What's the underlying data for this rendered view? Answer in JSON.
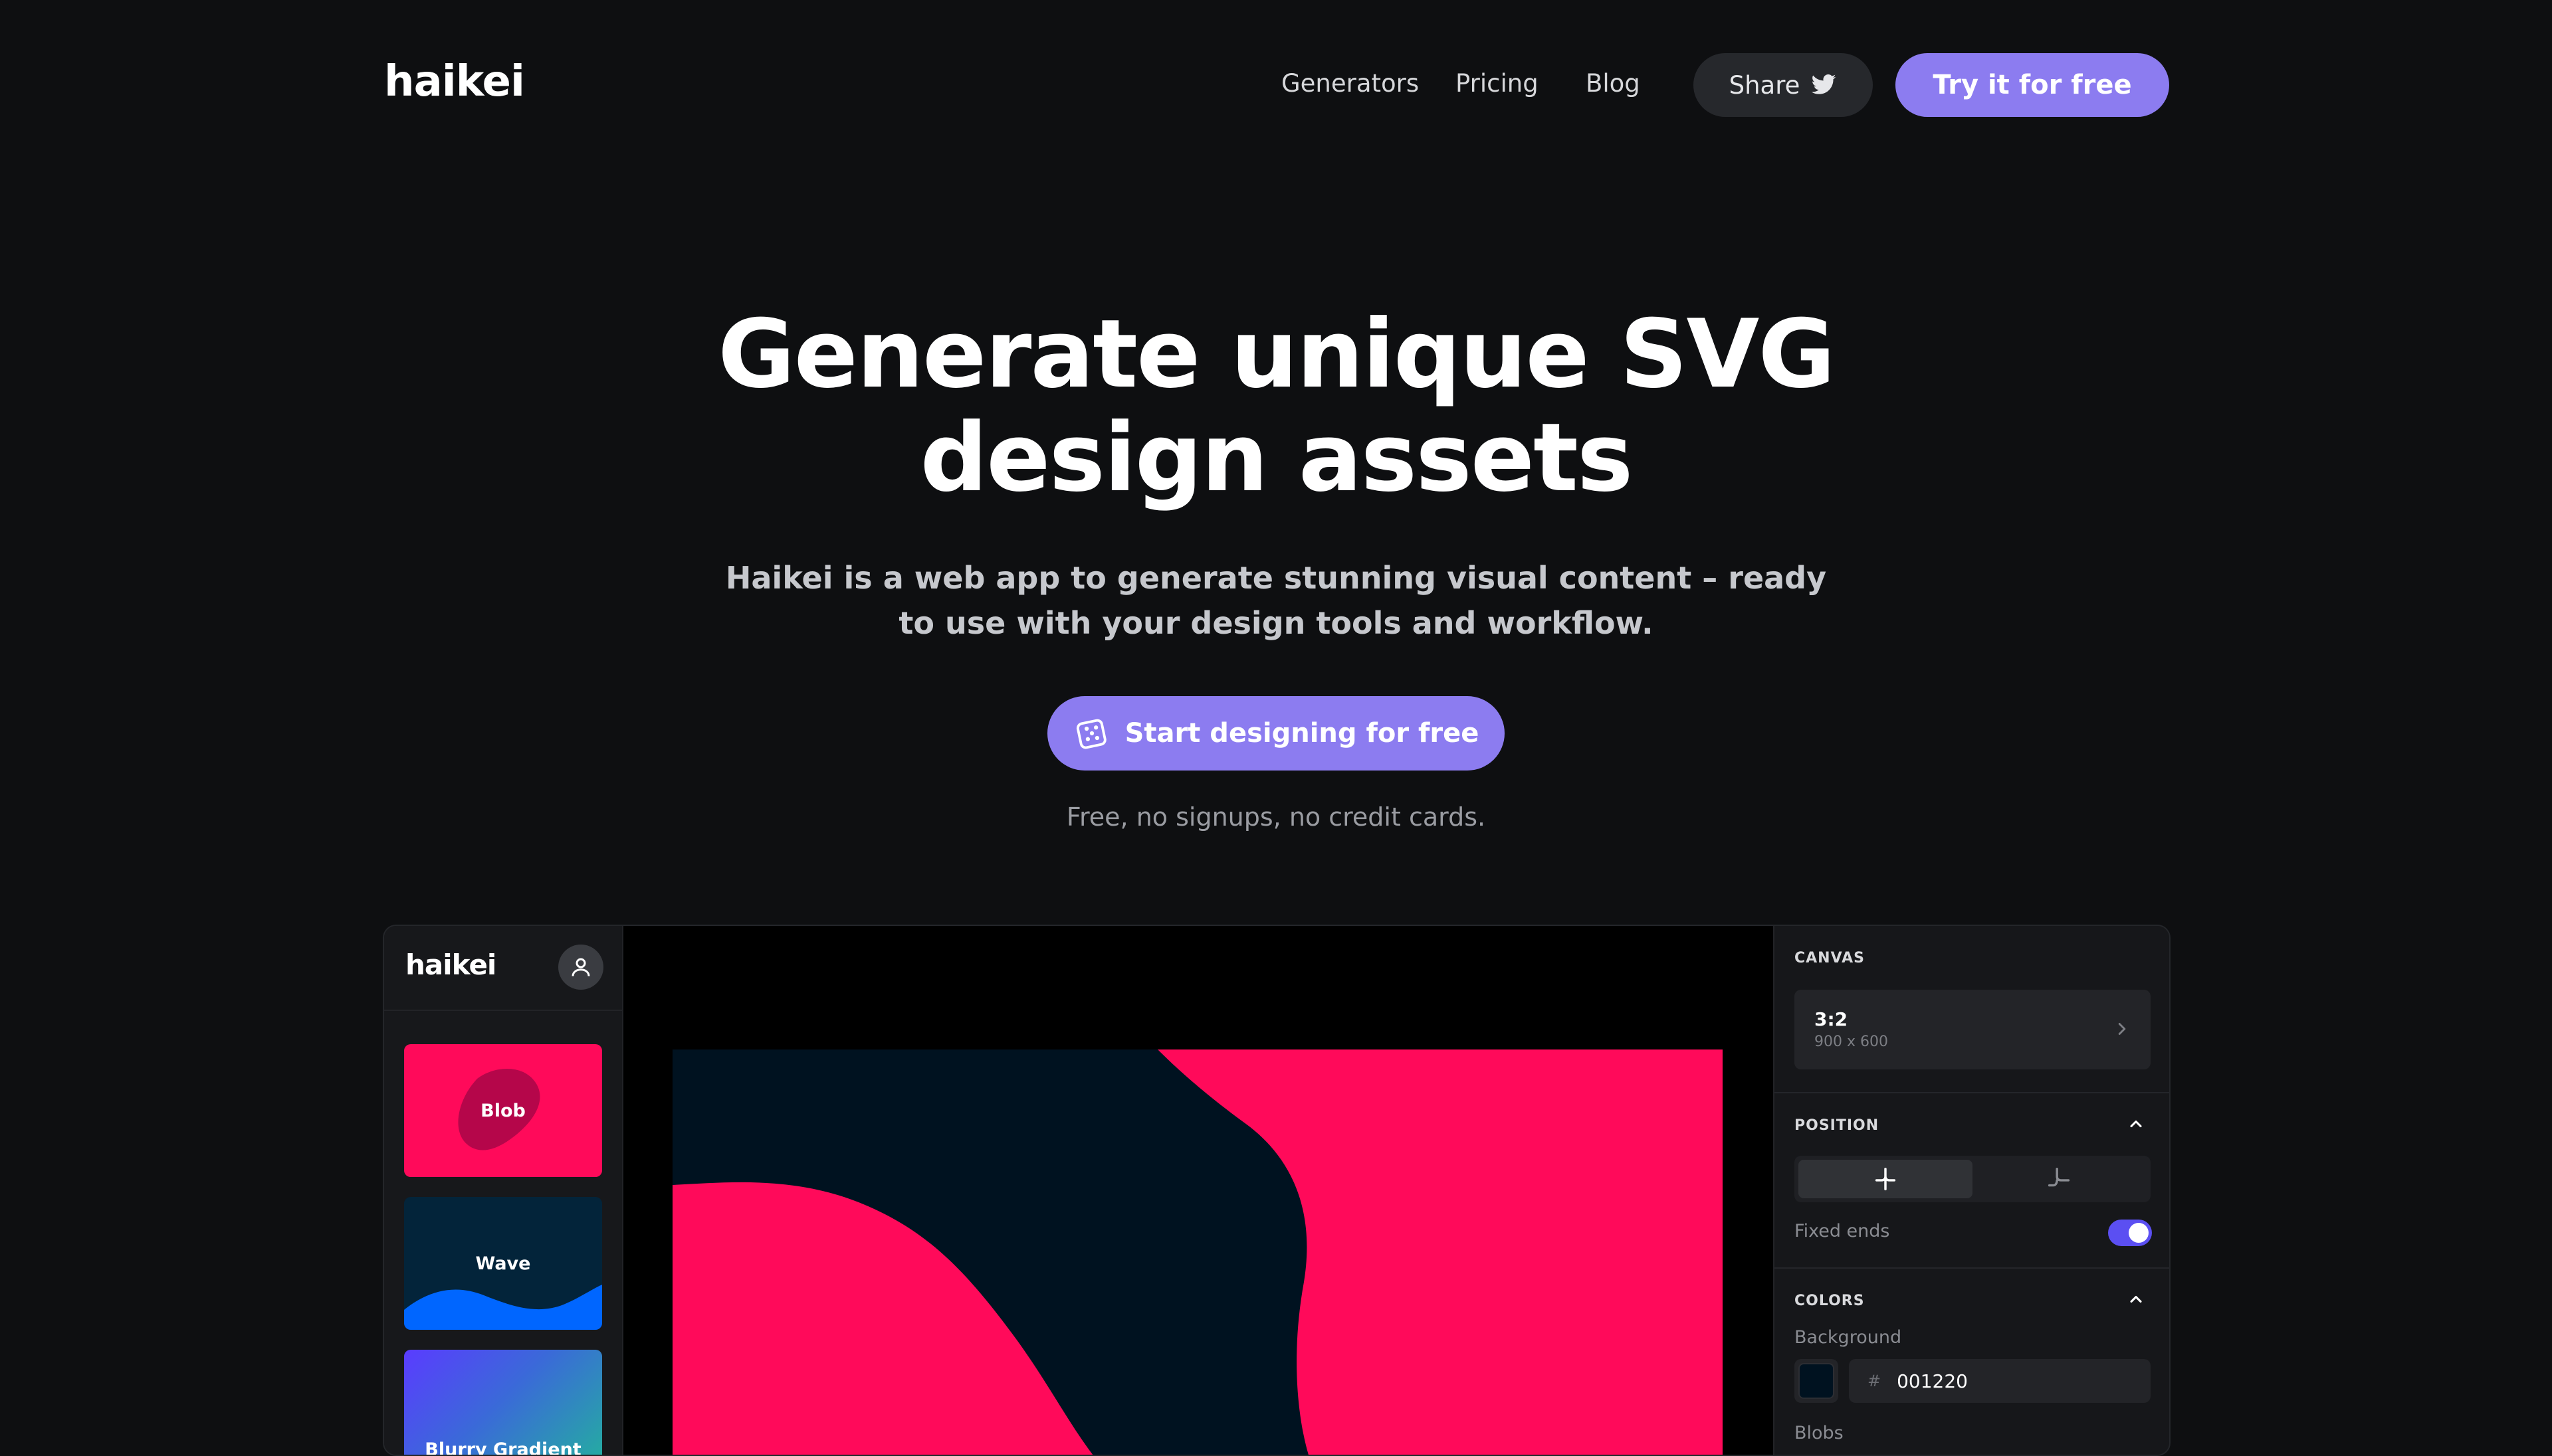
{
  "nav": {
    "logo": "haikei",
    "links": [
      "Generators",
      "Pricing",
      "Blog"
    ],
    "share_label": "Share",
    "try_label": "Try it for free"
  },
  "hero": {
    "title_line1": "Generate unique SVG",
    "title_line2": "design assets",
    "subtitle": "Haikei is a web app to generate stunning visual content – ready to use with your design tools and workflow.",
    "cta_label": "Start designing for free",
    "cta_note": "Free, no signups, no credit cards."
  },
  "app": {
    "logo": "haikei",
    "generators": [
      "Blob",
      "Wave",
      "Blurry Gradient"
    ],
    "panel": {
      "canvas_heading": "CANVAS",
      "canvas_ratio": "3:2",
      "canvas_size": "900 x 600",
      "position_heading": "POSITION",
      "fixed_ends_label": "Fixed ends",
      "fixed_ends_on": true,
      "colors_heading": "COLORS",
      "background_label": "Background",
      "background_hash": "#",
      "background_value": "001220",
      "blobs_label": "Blobs"
    }
  },
  "colors": {
    "accent": "#8c7cf0",
    "page_bg": "#0e0f11",
    "blob_pink": "#ff0a5a",
    "canvas_navy": "#001220",
    "toggle_on": "#5b4ff2",
    "wave_blue": "#0066ff"
  },
  "icons": {
    "share": "twitter-bird-icon",
    "cta": "dice-icon",
    "avatar": "user-icon",
    "section_toggle": "chevron-up-icon",
    "canvas_open": "chevron-right-icon"
  }
}
